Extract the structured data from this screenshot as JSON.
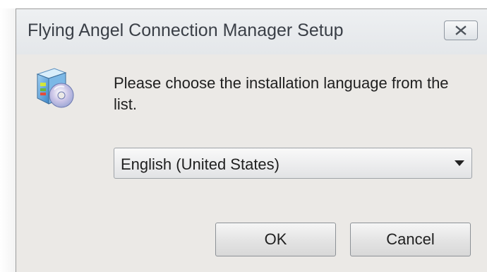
{
  "window": {
    "title": "Flying Angel Connection Manager Setup"
  },
  "dialog": {
    "message": "Please choose the installation language from the list.",
    "language_select": {
      "selected": "English (United States)"
    },
    "buttons": {
      "ok_label": "OK",
      "cancel_label": "Cancel"
    }
  },
  "icons": {
    "close": "close-icon",
    "app": "installer-cd-icon",
    "dropdown": "chevron-down-icon"
  }
}
